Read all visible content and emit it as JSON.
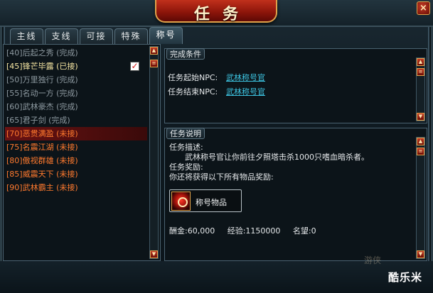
{
  "window": {
    "title": "任务",
    "close_label": "×"
  },
  "tabs": [
    {
      "label": "主线"
    },
    {
      "label": "支线"
    },
    {
      "label": "可接"
    },
    {
      "label": "特殊"
    },
    {
      "label": "称号"
    }
  ],
  "quests": [
    {
      "text": "[40]后起之秀  (完成)",
      "status": "done"
    },
    {
      "text": "[45]锋芒毕露  (已接)",
      "status": "active"
    },
    {
      "text": "[50]万里独行  (完成)",
      "status": "done"
    },
    {
      "text": "[55]名动一方  (完成)",
      "status": "done"
    },
    {
      "text": "[60]武林豪杰  (完成)",
      "status": "done"
    },
    {
      "text": "[65]君子剑  (完成)",
      "status": "done"
    },
    {
      "text": "[70]恶贯满盈  (未接)",
      "status": "todo"
    },
    {
      "text": "[75]名震江湖  (未接)",
      "status": "todo"
    },
    {
      "text": "[80]傲视群雄  (未接)",
      "status": "todo"
    },
    {
      "text": "[85]威震天下  (未接)",
      "status": "todo"
    },
    {
      "text": "[90]武林霸主  (未接)",
      "status": "todo"
    }
  ],
  "tracked_check": "✓",
  "conditions": {
    "header": "完成条件",
    "start_label": "任务起始NPC:",
    "start_npc": "武林称号官",
    "end_label": "任务结束NPC:",
    "end_npc": "武林称号官"
  },
  "description": {
    "header": "任务说明",
    "desc_label": "任务描述:",
    "desc_text": "武林称号官让你前往夕照塔击杀1000只嗜血暗杀者。",
    "reward_label": "任务奖励:",
    "reward_text": "你还将获得以下所有物品奖励:",
    "reward_item": "称号物品",
    "gold": "酬金:60,000",
    "exp": "经验:1150000",
    "fame": "名望:0"
  },
  "watermark": "酷乐米",
  "watermark_bg": "游侠",
  "scroll": {
    "up": "▲",
    "down": "▼",
    "thumb": "≡"
  },
  "colors": {
    "done": "#8e9aa1",
    "active": "#f7e7a3",
    "todo": "#ff7a2e",
    "link": "#3ec8e6",
    "accent": "#c0301c"
  }
}
